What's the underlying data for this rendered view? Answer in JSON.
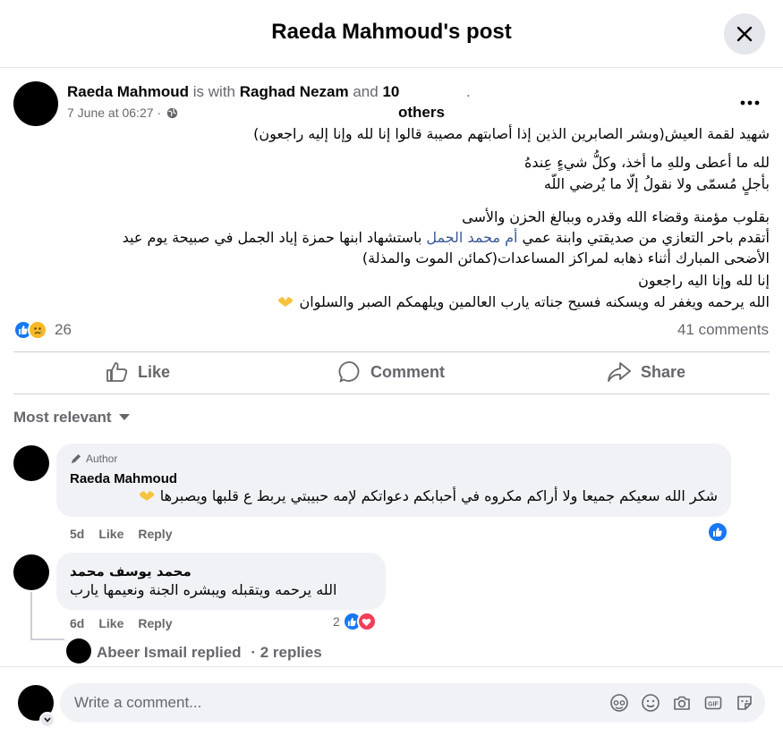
{
  "header": {
    "title": "Raeda Mahmoud's post"
  },
  "post": {
    "author": "Raeda Mahmoud",
    "with_text": "is with",
    "tagged": "Raghad Nezam",
    "and_text": "and",
    "others_count": "10",
    "others_label": "others",
    "dot": ".",
    "timestamp": "7 June at 06:27 ·",
    "privacy_icon": "globe-icon",
    "lines": {
      "l1": "شهيد لقمة العيش(وبشر الصابرين الذين إذا أصابتهم مصيبة قالوا إنا لله وإنا إليه راجعون)",
      "l2": "لله ما أعطى وللهِ ما أخذ، وكلُّ شيءٍ عِندهُ",
      "l3": "بأجلٍ مُسمّى ولا نقولُ إلّا ما يُرضي اللّه",
      "l4": "بقلوب مؤمنة وقضاء الله وقدره وببالغ الحزن والأسى",
      "l5_before": "أتقدم باحر التعازي من صديقتي وابنة عمي ",
      "l5_link": "أم محمد الجمل",
      "l5_after": " باستشهاد ابنها حمزة إياد الجمل في صبيحة يوم عيد",
      "l6": "الأضحى المبارك أثناء ذهابه لمراكز المساعدات(كمائن الموت والمذلة)",
      "l7": "إنا لله وإنا اليه راجعون",
      "l8": "الله يرحمه ويغفر له ويسكنه فسيح جناته يارب العالمين ويلهمكم الصبر والسلوان"
    },
    "reaction_count": "26",
    "comments_count": "41 comments"
  },
  "actions": {
    "like": "Like",
    "comment": "Comment",
    "share": "Share"
  },
  "sort_label": "Most relevant",
  "comments": [
    {
      "badge": "Author",
      "name": "Raeda Mahmoud",
      "text": "شكر الله سعيكم جميعا ولا أراكم مكروه في أحبابكم دعواتكم لإمه حبيبتي يربط ع قلبها ويصبرها",
      "age": "5d",
      "like": "Like",
      "reply": "Reply"
    },
    {
      "name": "محمد يوسف محمد",
      "text": "الله يرحمه ويتقبله ويبشره الجنة ونعيمها يارب",
      "age": "6d",
      "like": "Like",
      "reply": "Reply",
      "reaction_count": "2"
    }
  ],
  "replies": {
    "name": "Abeer Ismail replied",
    "count": "· 2 replies"
  },
  "composer": {
    "placeholder": "Write a comment..."
  },
  "colors": {
    "like_blue": "#1877f2",
    "love_red": "#f33e58",
    "link": "#385898",
    "muted": "#65676b"
  }
}
